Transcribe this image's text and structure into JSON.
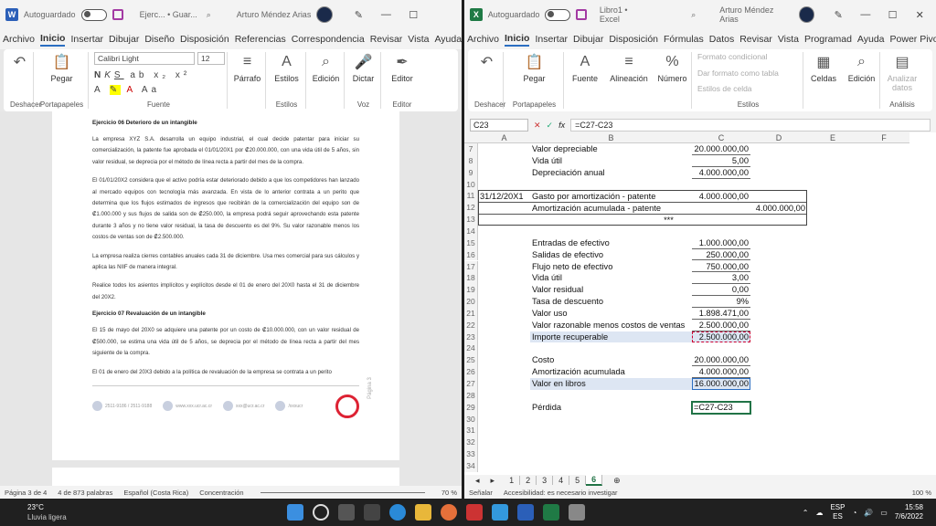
{
  "word": {
    "autosave": "Autoguardado",
    "doc_title": "Ejerc... • Guar...",
    "user": "Arturo Méndez Arias",
    "menu": [
      "Archivo",
      "Inicio",
      "Insertar",
      "Dibujar",
      "Diseño",
      "Disposición",
      "Referencias",
      "Correspondencia",
      "Revisar",
      "Vista",
      "Ayuda"
    ],
    "ribbon": {
      "undo_label": "Deshacer",
      "paste": "Pegar",
      "clipboard": "Portapapeles",
      "font_name": "Calibri Light",
      "font_size": "12",
      "font_group": "Fuente",
      "paragraph": "Párrafo",
      "styles": "Estilos",
      "styles_group": "Estilos",
      "edition": "Edición",
      "dictate": "Dictar",
      "voice": "Voz",
      "editor": "Editor",
      "editor_group": "Editor"
    },
    "doc": {
      "h1": "Ejercicio 06 Deterioro de un intangible",
      "p1": "La empresa XYZ S.A. desarrolla un equipo industrial, el cual decide patentar para iniciar su comercialización, la patente fue aprobada el 01/01/20X1 por ₡20.000.000, con una vida útil de 5 años, sin valor residual, se deprecia por el método de línea recta a partir del mes de la compra.",
      "p2": "El 01/01/20X2 considera que el activo podría estar deteriorado debido a que los competidores han lanzado al mercado equipos con tecnología más avanzada. En vista de lo anterior contrata a un perito que determina que los flujos estimados de ingresos que recibirán de la comercialización del equipo son de ₡1.000.000 y sus flujos de salida son de ₡250.000, la empresa podrá seguir aprovechando esta patente durante 3 años y no tiene valor residual, la tasa de descuento es del 9%. Su valor razonable menos los costos de ventas son de ₡2.500.000.",
      "p3": "La empresa realiza cierres contables anuales cada 31 de diciembre. Usa mes comercial para sus cálculos y aplica las NIIF de manera integral.",
      "p4": "Realice todos los asientos implícitos y explícitos desde el 01 de enero del 20X0 hasta el 31 de diciembre del 20X2.",
      "h2": "Ejercicio 07 Revaluación de un intangible",
      "p5": "El 15 de mayo del 20X0 se adquiere una patente por un costo de ₡10.000.000, con un valor residual de ₡500.000, se estima una vida útil de 5 años, se deprecia por el método de línea recta a partir del mes siguiente de la compra.",
      "p6": "El 01 de enero del 20X3 debido a la política de revaluación de la empresa se contrata a un perito",
      "footer": [
        "2511-9186 / 2511-9188",
        "www.xxx.ucr.ac.cr",
        "xxx@ucr.ac.cr",
        "/xxxucr"
      ],
      "page_label": "Página 3"
    },
    "status": {
      "page": "Página 3 de 4",
      "words": "4 de 873 palabras",
      "lang": "Español (Costa Rica)",
      "focus": "Concentración",
      "zoom": "70 %"
    }
  },
  "excel": {
    "autosave": "Autoguardado",
    "title": "Libro1 • Excel",
    "user": "Arturo Méndez Arias",
    "menu": [
      "Archivo",
      "Inicio",
      "Insertar",
      "Dibujar",
      "Disposición",
      "Fórmulas",
      "Datos",
      "Revisar",
      "Vista",
      "Programad",
      "Ayuda",
      "Power Pivot"
    ],
    "ribbon": {
      "undo": "Deshacer",
      "paste": "Pegar",
      "clipboard": "Portapapeles",
      "font": "Fuente",
      "alignment": "Alineación",
      "number": "Número",
      "cond_format": "Formato condicional",
      "table_format": "Dar formato como tabla",
      "cell_styles": "Estilos de celda",
      "styles_group": "Estilos",
      "cells": "Celdas",
      "edit": "Edición",
      "analyze": "Analizar datos",
      "analysis": "Análisis"
    },
    "namebox": "C23",
    "formula": "=C27-C23",
    "cols": [
      "A",
      "B",
      "C",
      "D",
      "E",
      "F"
    ],
    "rows": [
      {
        "n": "7",
        "b": "Valor depreciable",
        "c": "20.000.000,00"
      },
      {
        "n": "8",
        "b": "Vida útil",
        "c": "5,00"
      },
      {
        "n": "9",
        "b": "Depreciación anual",
        "c": "4.000.000,00"
      },
      {
        "n": "10"
      },
      {
        "n": "11",
        "a": "31/12/20X1",
        "b": "Gasto por amortización - patente",
        "c": "4.000.000,00"
      },
      {
        "n": "12",
        "b": "   Amortización acumulada - patente",
        "d": "4.000.000,00"
      },
      {
        "n": "13",
        "b": "***"
      },
      {
        "n": "14"
      },
      {
        "n": "15",
        "b": "Entradas de efectivo",
        "c": "1.000.000,00"
      },
      {
        "n": "16",
        "b": "Salidas de efectivo",
        "c": "250.000,00"
      },
      {
        "n": "17",
        "b": "Flujo neto de efectivo",
        "c": "750.000,00"
      },
      {
        "n": "18",
        "b": "Vida útil",
        "c": "3,00"
      },
      {
        "n": "19",
        "b": "Valor residual",
        "c": "0,00"
      },
      {
        "n": "20",
        "b": "Tasa de descuento",
        "c": "9%"
      },
      {
        "n": "21",
        "b": "Valor uso",
        "c": "1.898.471,00"
      },
      {
        "n": "22",
        "b": "Valor razonable menos costos de ventas",
        "c": "2.500.000,00"
      },
      {
        "n": "23",
        "b": "Importe recuperable",
        "c": "2.500.000,00"
      },
      {
        "n": "24"
      },
      {
        "n": "25",
        "b": "Costo",
        "c": "20.000.000,00"
      },
      {
        "n": "26",
        "b": "Amortización acumulada",
        "c": "4.000.000,00"
      },
      {
        "n": "27",
        "b": "Valor en libros",
        "c": "16.000.000,00"
      },
      {
        "n": "28"
      },
      {
        "n": "29",
        "b": "Pérdida",
        "c": "=C27-C23"
      },
      {
        "n": "30"
      },
      {
        "n": "31"
      },
      {
        "n": "32"
      },
      {
        "n": "33"
      },
      {
        "n": "34"
      }
    ],
    "sheets": [
      "1",
      "2",
      "3",
      "4",
      "5",
      "6"
    ],
    "status": {
      "mode": "Señalar",
      "access": "Accesibilidad: es necesario investigar",
      "zoom": "100 %"
    }
  },
  "taskbar": {
    "temp": "23°C",
    "weather": "Lluvia ligera",
    "lang1": "ESP",
    "lang2": "ES",
    "time": "15:58",
    "date": "7/6/2022"
  }
}
